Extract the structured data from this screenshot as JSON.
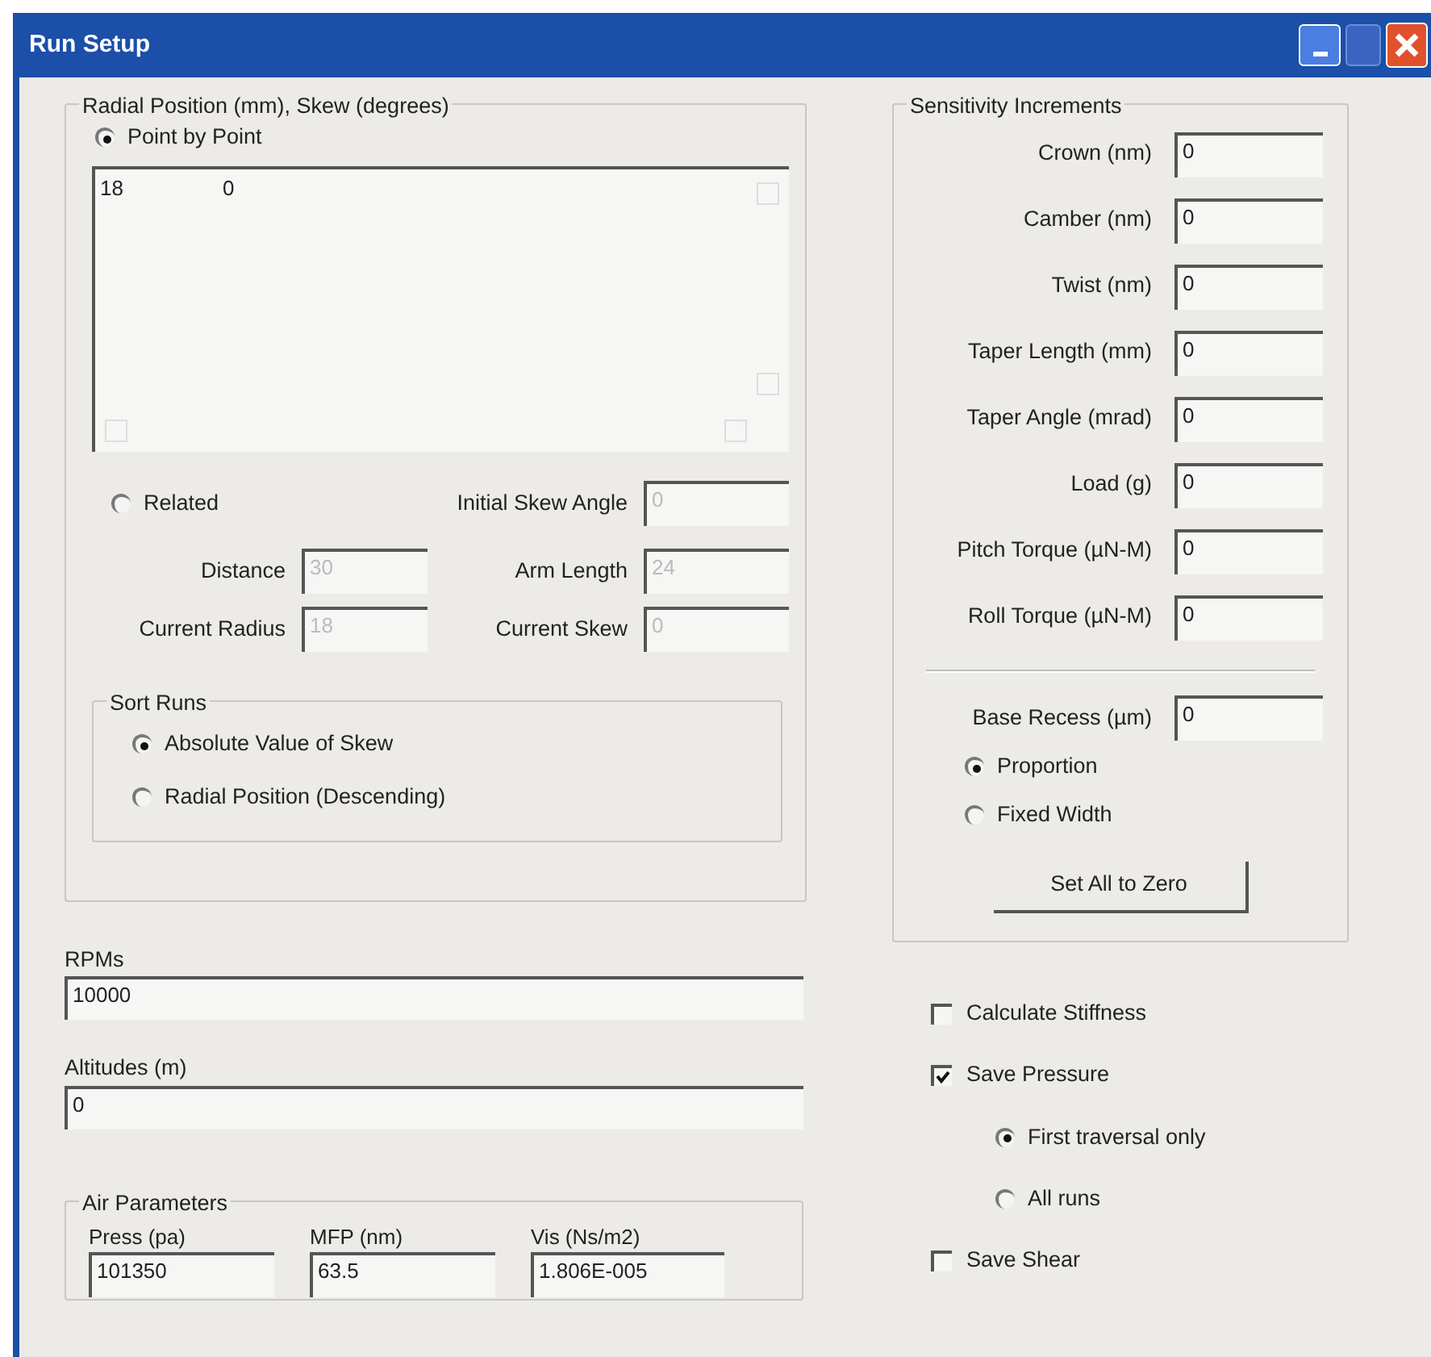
{
  "window": {
    "title": "Run Setup"
  },
  "position_group": {
    "title": "Radial Position (mm), Skew (degrees)",
    "modes": [
      {
        "label": "Point by Point",
        "selected": true
      },
      {
        "label": "Related",
        "selected": false
      }
    ],
    "point_list": [
      {
        "radius": "18",
        "skew": "0"
      }
    ],
    "related_fields": [
      {
        "label": "Initial Skew Angle",
        "value": "0",
        "disabled": true
      },
      {
        "label": "Distance",
        "value": "30",
        "disabled": true
      },
      {
        "label": "Arm Length",
        "value": "24",
        "disabled": true
      },
      {
        "label": "Current Radius",
        "value": "18",
        "disabled": true
      },
      {
        "label": "Current Skew",
        "value": "0",
        "disabled": true
      }
    ],
    "sort_runs": {
      "title": "Sort Runs",
      "options": [
        {
          "label": "Absolute Value of Skew",
          "selected": true
        },
        {
          "label": "Radial Position (Descending)",
          "selected": false
        }
      ]
    }
  },
  "rpms": {
    "label": "RPMs",
    "value": "10000"
  },
  "altitudes": {
    "label": "Altitudes (m)",
    "value": "0"
  },
  "air_parameters": {
    "title": "Air Parameters",
    "fields": [
      {
        "label": "Press (pa)",
        "value": "101350"
      },
      {
        "label": "MFP (nm)",
        "value": "63.5"
      },
      {
        "label": "Vis (Ns/m2)",
        "value": "1.806E-005"
      }
    ]
  },
  "sensitivity": {
    "title": "Sensitivity Increments",
    "fields": [
      {
        "label": "Crown (nm)",
        "value": "0"
      },
      {
        "label": "Camber (nm)",
        "value": "0"
      },
      {
        "label": "Twist (nm)",
        "value": "0"
      },
      {
        "label": "Taper Length (mm)",
        "value": "0"
      },
      {
        "label": "Taper Angle (mrad)",
        "value": "0"
      },
      {
        "label": "Load (g)",
        "value": "0"
      },
      {
        "label": "Pitch Torque (µN-M)",
        "value": "0"
      },
      {
        "label": "Roll Torque (µN-M)",
        "value": "0"
      }
    ],
    "base_recess": {
      "label": "Base Recess (µm)",
      "value": "0"
    },
    "recess_modes": [
      {
        "label": "Proportion",
        "selected": true
      },
      {
        "label": "Fixed Width",
        "selected": false
      }
    ],
    "button": "Set All to Zero"
  },
  "options": [
    {
      "kind": "checkbox",
      "label": "Calculate Stiffness",
      "checked": false
    },
    {
      "kind": "checkbox",
      "label": "Save Pressure",
      "checked": true
    },
    {
      "kind": "radio",
      "label": "First traversal only",
      "selected": true
    },
    {
      "kind": "radio",
      "label": "All runs",
      "selected": false
    },
    {
      "kind": "checkbox",
      "label": "Save Shear",
      "checked": false
    }
  ]
}
